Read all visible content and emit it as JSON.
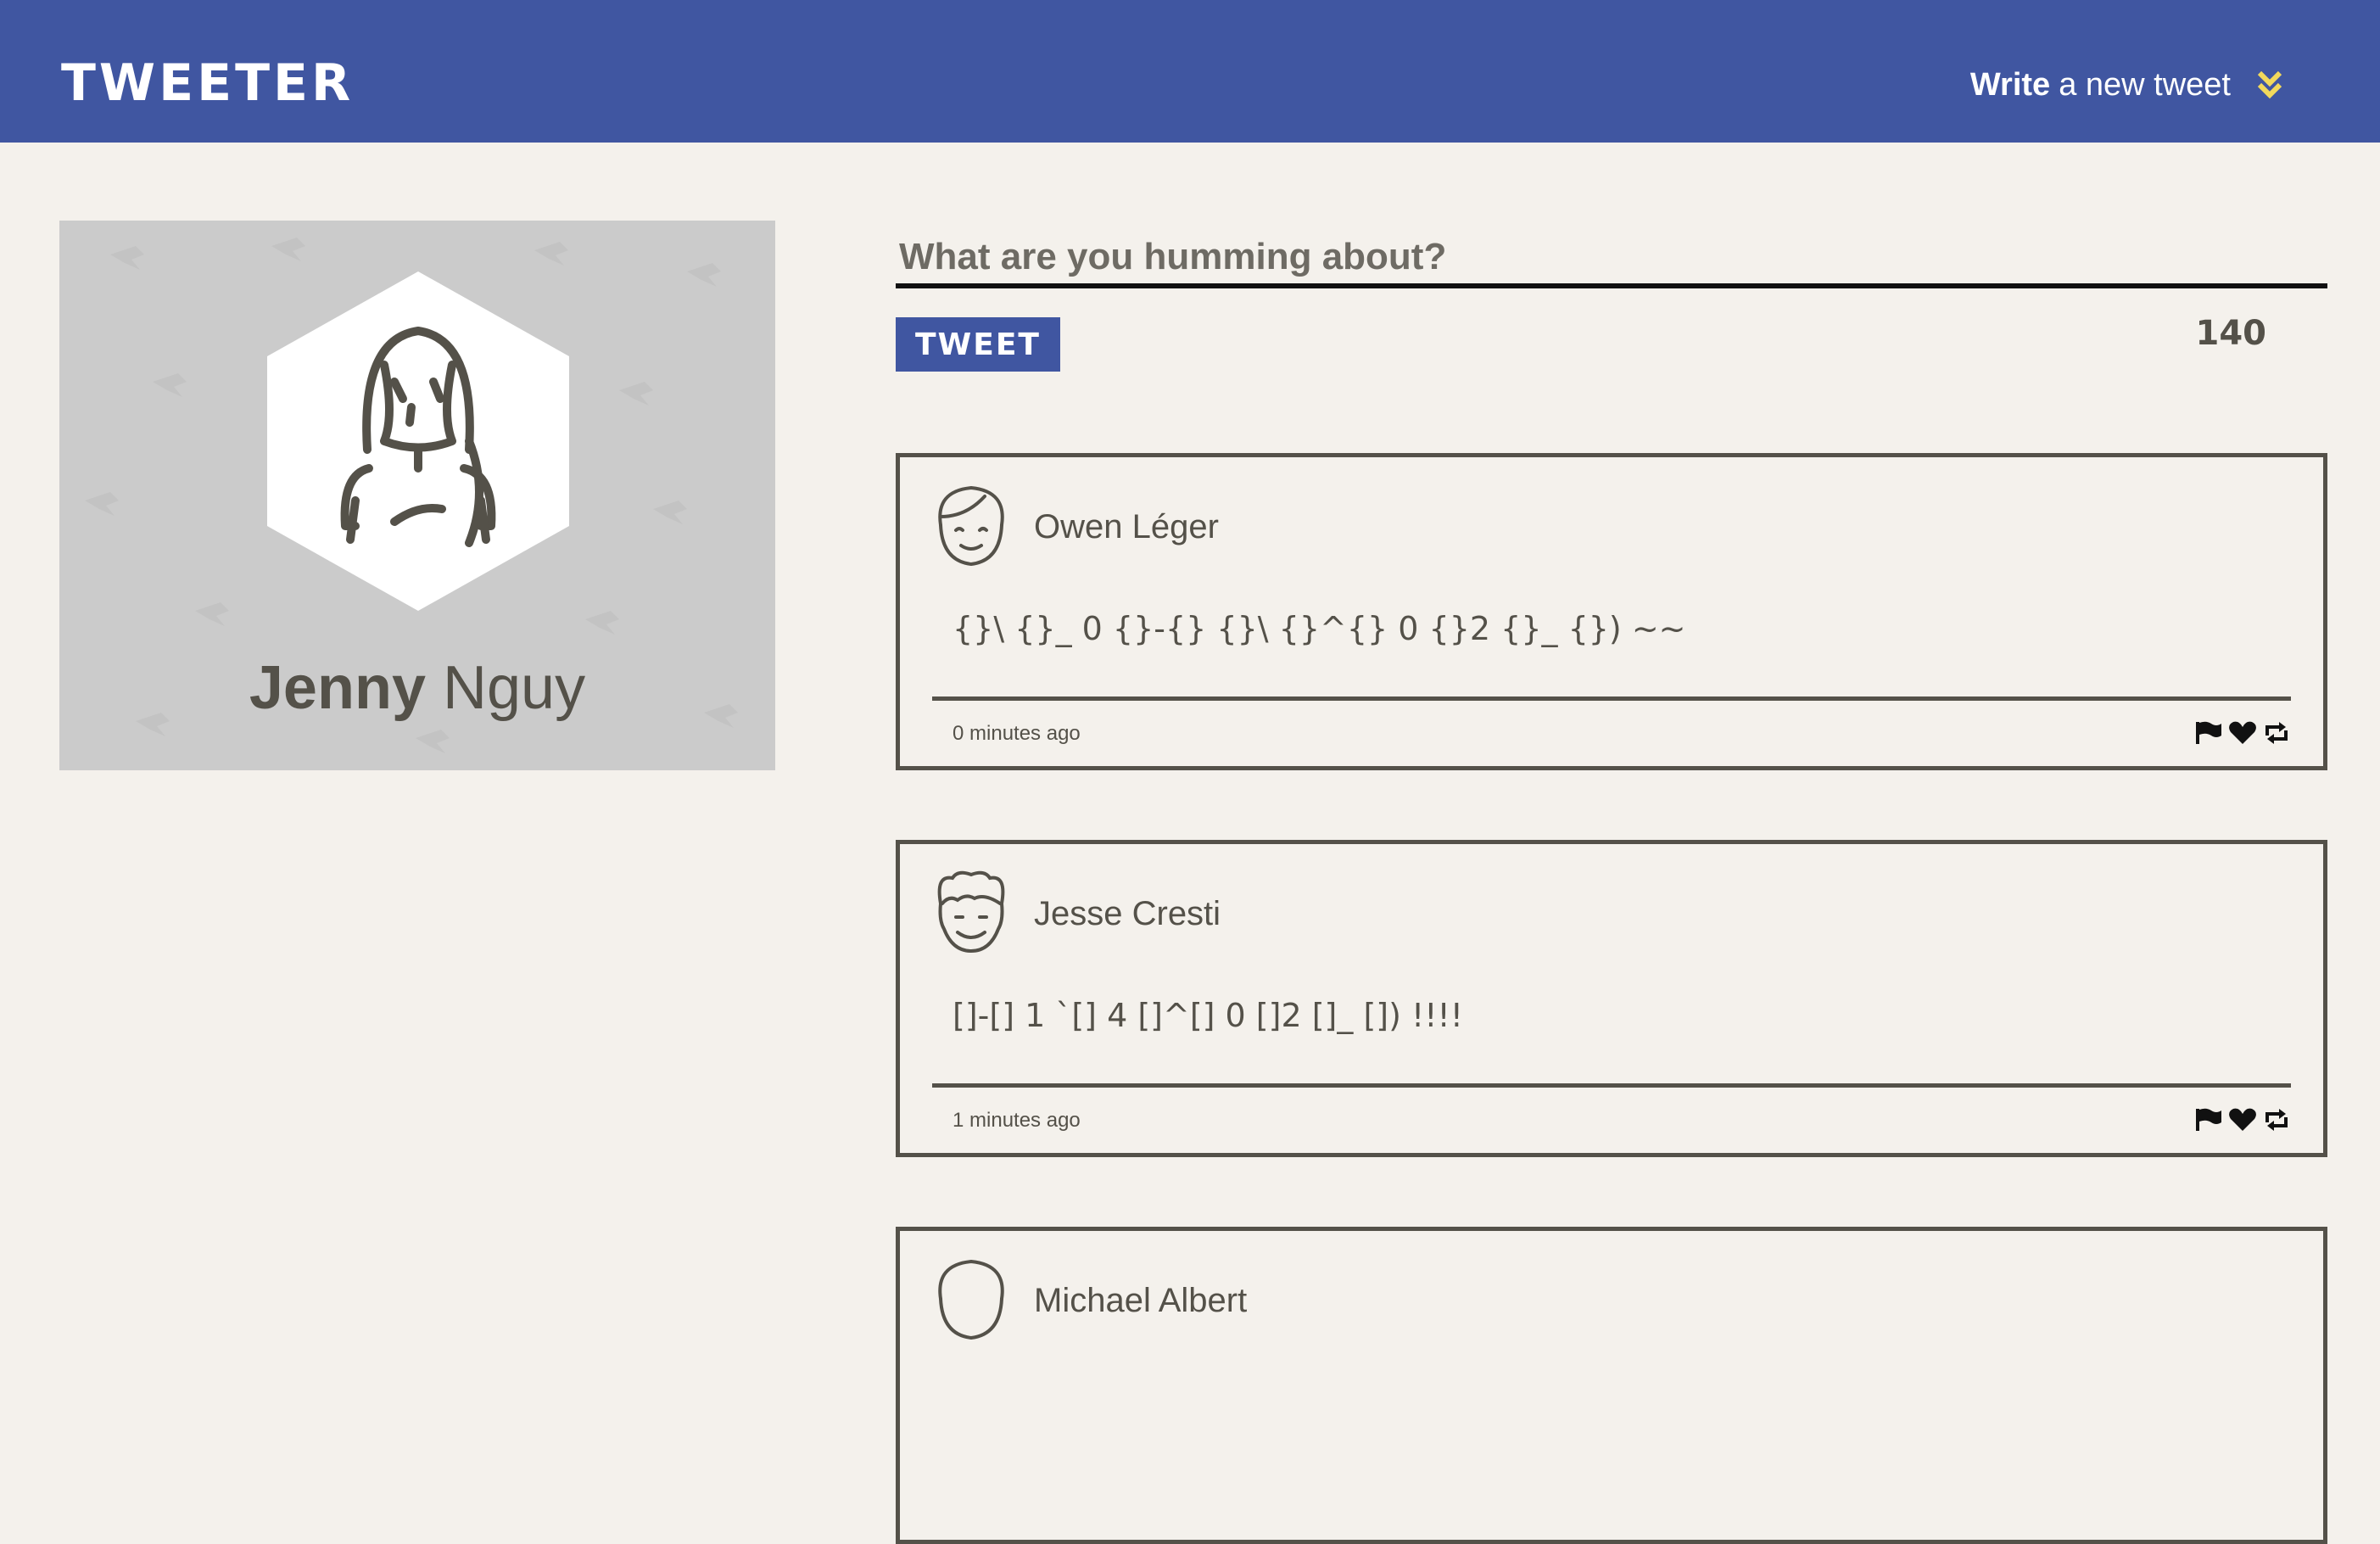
{
  "header": {
    "logo": "TWEETER",
    "compose_strong": "Write",
    "compose_rest": "a new tweet",
    "compose_icon": "double-chevron-down-icon",
    "accent_color": "#f2d95c",
    "bar_color": "#4056a1"
  },
  "profile": {
    "first_name": "Jenny",
    "last_name": "Nguy",
    "avatar_icon": "woman-avatar-icon"
  },
  "composer": {
    "placeholder": "What are you humming about?",
    "button_label": "TWEET",
    "counter": "140"
  },
  "tweets": [
    {
      "author": "Owen Léger",
      "avatar_icon": "smiling-man-avatar-icon",
      "content": "{}\\ {}_ 0 {}-{} {}\\ {}^{} 0 {}2 {}_ {}) ~~",
      "time": "0 minutes ago"
    },
    {
      "author": "Jesse Cresti",
      "avatar_icon": "curly-hair-man-avatar-icon",
      "content": "[]-[] 1 `[] 4 []^[] 0 []2 []_ []) !!!!",
      "time": "1 minutes ago"
    },
    {
      "author": "Michael Albert",
      "avatar_icon": "man-avatar-icon",
      "content": "",
      "time": ""
    }
  ],
  "tweet_actions": [
    "flag-icon",
    "heart-icon",
    "retweet-icon"
  ]
}
